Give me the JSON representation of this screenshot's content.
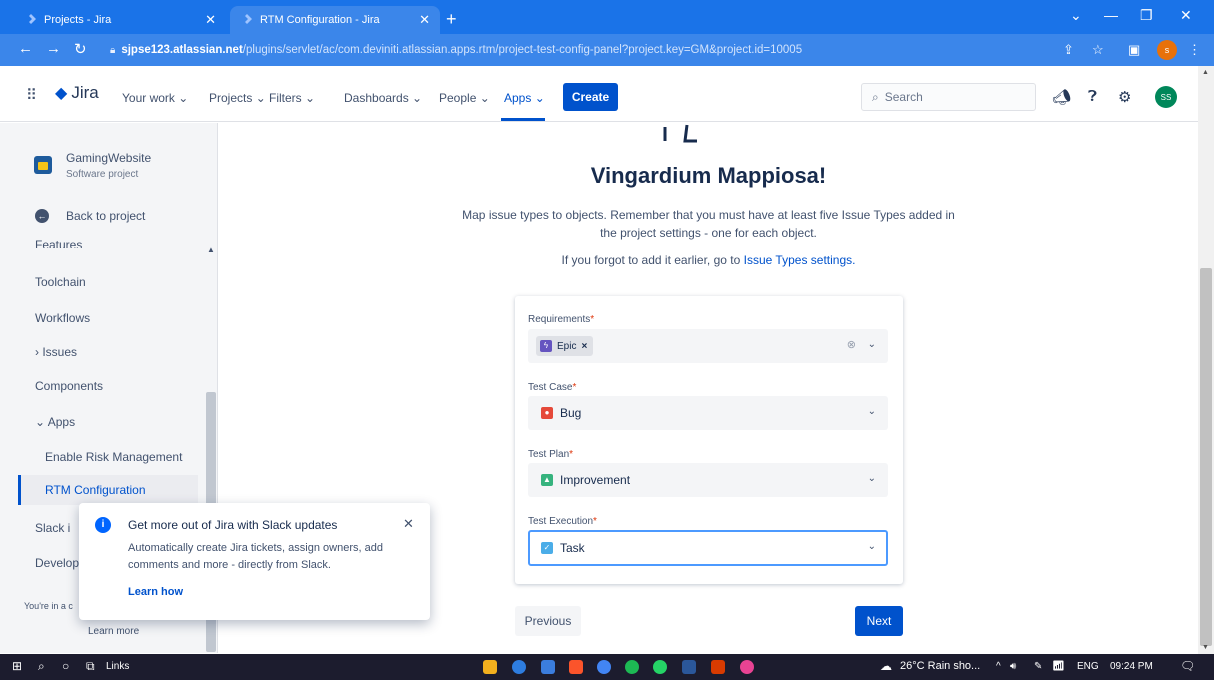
{
  "browser": {
    "tabs": [
      {
        "title": "Projects - Jira"
      },
      {
        "title": "RTM Configuration - Jira"
      }
    ],
    "url_host": "sjpse123.atlassian.net",
    "url_path": "/plugins/servlet/ac/com.deviniti.atlassian.apps.rtm/project-test-config-panel?project.key=GM&project.id=10005",
    "profile_initial": "s"
  },
  "jira": {
    "logo_text": "Jira",
    "nav": {
      "your_work": "Your work",
      "projects": "Projects",
      "filters": "Filters",
      "dashboards": "Dashboards",
      "people": "People",
      "apps": "Apps"
    },
    "create_label": "Create",
    "search_placeholder": "Search",
    "avatar_initials": "SS"
  },
  "sidebar": {
    "project_name": "GamingWebsite",
    "project_type": "Software project",
    "back_label": "Back to project",
    "items": {
      "features": "Features",
      "toolchain": "Toolchain",
      "workflows": "Workflows",
      "issues": "Issues",
      "components": "Components",
      "apps": "Apps",
      "enable_risk": "Enable Risk Management",
      "rtm_config": "RTM Configuration",
      "slack": "Slack i",
      "develop": "Develop"
    },
    "youre_in": "You're in a c",
    "learn_more": "Learn more"
  },
  "main": {
    "headline": "Vingardium Mappiosa!",
    "description_line1": "Map issue types to objects. Remember that you must have at least five Issue Types added in",
    "description_line2": "the project settings - one for each object.",
    "forgot_text": "If you forgot to add it earlier, go to ",
    "issue_types_link": "Issue Types settings.",
    "fields": {
      "requirements": {
        "label": "Requirements",
        "value": "Epic"
      },
      "test_case": {
        "label": "Test Case",
        "value": "Bug"
      },
      "test_plan": {
        "label": "Test Plan",
        "value": "Improvement"
      },
      "test_execution": {
        "label": "Test Execution",
        "value": "Task"
      }
    },
    "required_mark": "*",
    "previous_label": "Previous",
    "next_label": "Next"
  },
  "toast": {
    "title": "Get more out of Jira with Slack updates",
    "body": "Automatically create Jira tickets, assign owners, add comments and more - directly from Slack.",
    "link": "Learn how"
  },
  "taskbar": {
    "links_label": "Links",
    "weather": "26°C Rain sho...",
    "language": "ENG",
    "time": "09:24 PM"
  },
  "colors": {
    "browser_blue": "#1a73e8",
    "jira_blue": "#0052cc",
    "epic": "#6554c0",
    "bug": "#e5493a",
    "improvement": "#36b37e",
    "task": "#4bade8"
  }
}
